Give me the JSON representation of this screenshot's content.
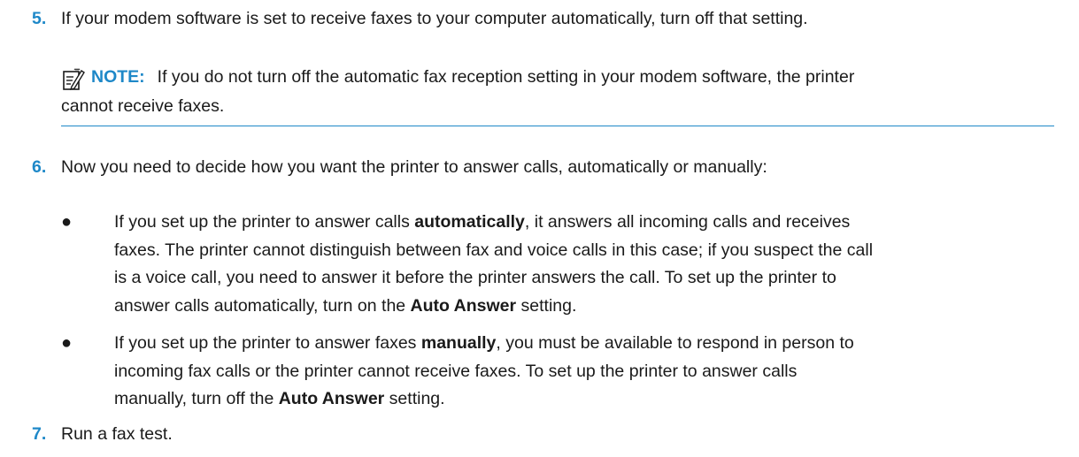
{
  "steps": [
    {
      "number": "5.",
      "text": "If your modem software is set to receive faxes to your computer automatically, turn off that setting."
    },
    {
      "number": "6.",
      "text": "Now you need to decide how you want the printer to answer calls, automatically or manually:"
    },
    {
      "number": "7.",
      "text": "Run a fax test."
    }
  ],
  "note": {
    "icon": "note-icon",
    "label": "NOTE:",
    "line1": "If you do not turn off the automatic fax reception setting in your modem software, the printer",
    "line2": "cannot receive faxes."
  },
  "bullets": [
    {
      "glyph": "●",
      "l1_pre": "If you set up the printer to answer calls ",
      "l1_bold": "automatically",
      "l1_post": ", it answers all incoming calls and receives",
      "l2": "faxes. The printer cannot distinguish between fax and voice calls in this case; if you suspect the call",
      "l3": "is a voice call, you need to answer it before the printer answers the call. To set up the printer to",
      "l4_pre": "answer calls automatically, turn on the ",
      "l4_bold": "Auto Answer",
      "l4_post": " setting."
    },
    {
      "glyph": "●",
      "l1_pre": "If you set up the printer to answer faxes ",
      "l1_bold": "manually",
      "l1_post": ", you must be available to respond in person to",
      "l2": "incoming fax calls or the printer cannot receive faxes. To set up the printer to answer calls",
      "l3_pre": "manually, turn off the ",
      "l3_bold": "Auto Answer",
      "l3_post": " setting."
    }
  ],
  "colors": {
    "accent": "#1e88c8",
    "text": "#1a1a1a"
  }
}
